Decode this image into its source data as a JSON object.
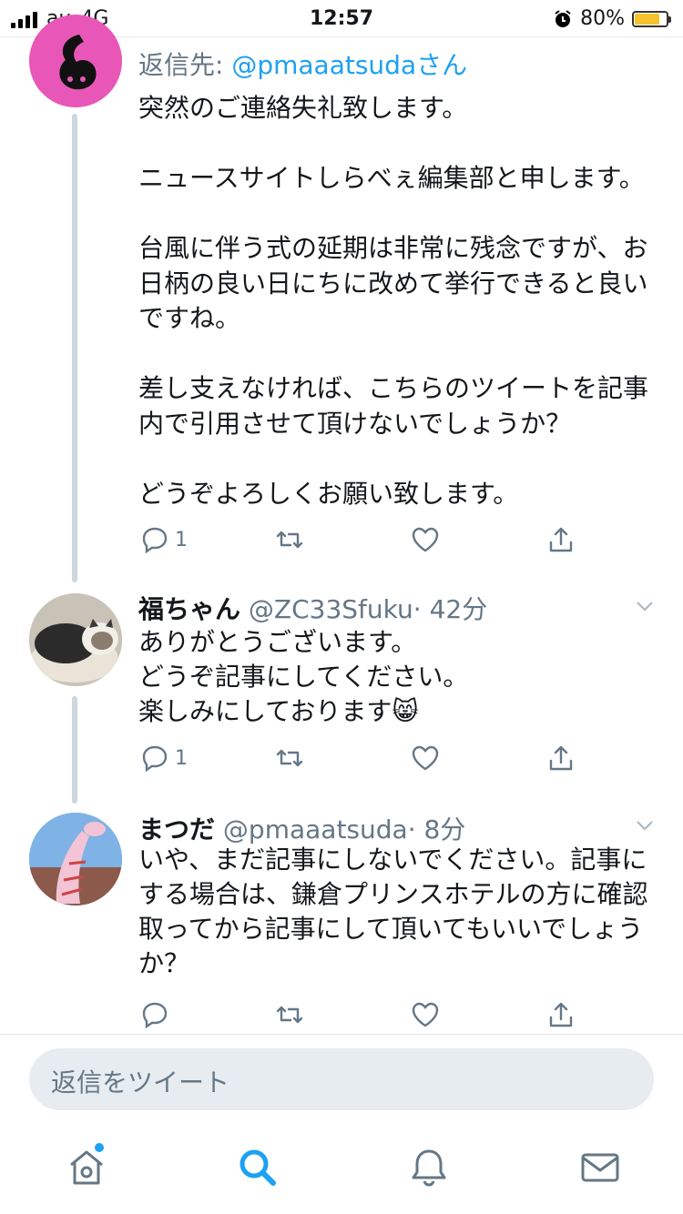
{
  "status": {
    "carrier": "au",
    "network": "4G",
    "time": "12:57",
    "battery": "80%",
    "battery_level": 0.8,
    "battery_color": "#f6c12b"
  },
  "tweets": [
    {
      "reply_prefix": "返信先: ",
      "reply_handle": "@pmaaatsudaさん",
      "text": "突然のご連絡失礼致します。\n\nニュースサイトしらべぇ編集部と申します。\n\n台風に伴う式の延期は非常に残念ですが、お日柄の良い日にちに改めて挙行できると良いですね。\n\n差し支えなければ、こちらのツイートを記事内で引用させて頂けないでしょうか？\n\nどうぞよろしくお願い致します。",
      "reply_count": "1",
      "avatar_color": "#e857b8"
    },
    {
      "name": "福ちゃん",
      "handle": "@ZC33Sfuku",
      "time": "· 42分",
      "text": "ありがとうございます。\nどうぞ記事にしてください。\n楽しみにしております😸",
      "reply_count": "1"
    },
    {
      "name": "まつだ",
      "handle": "@pmaaatsuda",
      "time": "· 8分",
      "text": "いや、まだ記事にしないでください。記事にする場合は、鎌倉プリンスホテルの方に確認取ってから記事にして頂いてもいいでしょうか？",
      "reply_count": ""
    }
  ],
  "compose": {
    "placeholder": "返信をツイート"
  },
  "colors": {
    "accent": "#1da1f2",
    "secondary_text": "#657786",
    "thread_line": "#ccd6dd"
  },
  "tabs": [
    "home-icon",
    "search-icon",
    "notifications-icon",
    "messages-icon"
  ]
}
